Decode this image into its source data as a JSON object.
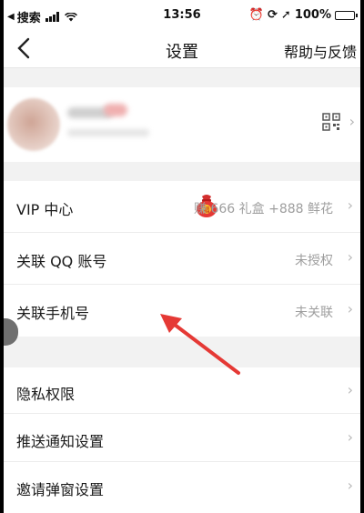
{
  "status_bar": {
    "carrier": "搜索",
    "time": "13:56",
    "battery": "100%"
  },
  "nav": {
    "title": "设置",
    "help": "帮助与反馈"
  },
  "settings": {
    "account": [
      {
        "label": "VIP 中心",
        "value": "赚 666 礼盒 +888 鲜花"
      },
      {
        "label": "关联 QQ 账号",
        "value": "未授权"
      },
      {
        "label": "关联手机号",
        "value": "未关联"
      }
    ],
    "general": [
      {
        "label": "隐私权限",
        "value": ""
      },
      {
        "label": "推送通知设置",
        "value": ""
      },
      {
        "label": "邀请弹窗设置",
        "value": ""
      }
    ]
  },
  "icons": {
    "back": "chevron-left-icon",
    "qr": "qr-code-icon",
    "gift": "lucky-bag-icon"
  },
  "colors": {
    "annotation_arrow": "#e53935",
    "background": "#f2f2f2"
  }
}
